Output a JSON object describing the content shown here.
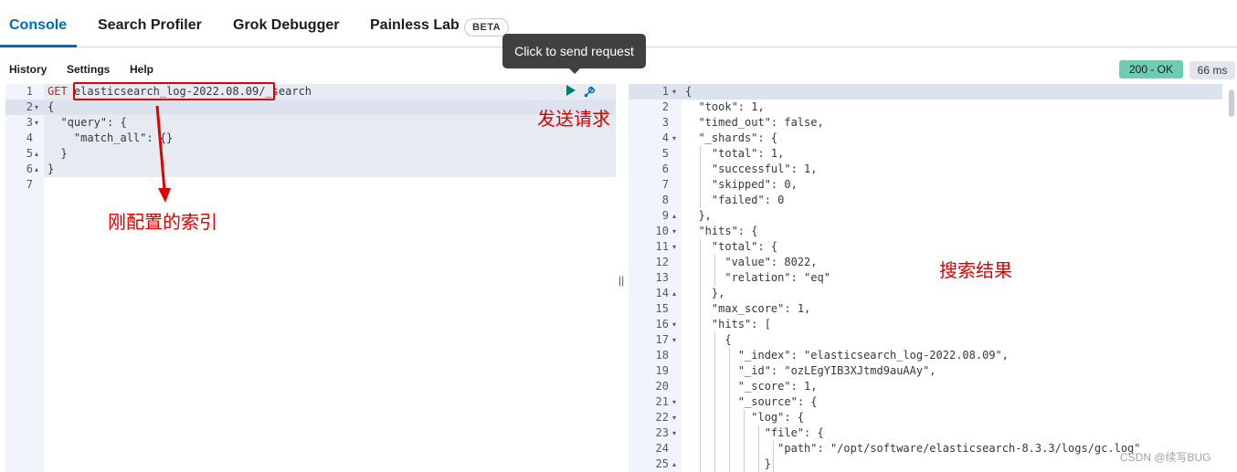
{
  "tabs": [
    {
      "label": "Console",
      "active": true
    },
    {
      "label": "Search Profiler",
      "active": false
    },
    {
      "label": "Grok Debugger",
      "active": false
    },
    {
      "label": "Painless Lab",
      "active": false
    }
  ],
  "beta_badge": "BETA",
  "menu": {
    "history": "History",
    "settings": "Settings",
    "help": "Help"
  },
  "tooltip": "Click to send request",
  "response": {
    "status": "200 - OK",
    "time": "66 ms"
  },
  "request": {
    "method": "GET",
    "index": "elasticsearch_log-2022.08.09",
    "path": "/_search",
    "lines": [
      {
        "n": "1",
        "fold": "",
        "text": ""
      },
      {
        "n": "2",
        "fold": "▾",
        "text": "{"
      },
      {
        "n": "3",
        "fold": "▾",
        "text": "  \"query\": {"
      },
      {
        "n": "4",
        "fold": "",
        "text": "    \"match_all\": {}"
      },
      {
        "n": "5",
        "fold": "▴",
        "text": "  }"
      },
      {
        "n": "6",
        "fold": "▴",
        "text": "}"
      },
      {
        "n": "7",
        "fold": "",
        "text": ""
      }
    ]
  },
  "response_lines": [
    {
      "n": "1",
      "fold": "▾",
      "text": "{"
    },
    {
      "n": "2",
      "fold": "",
      "text": "  \"took\": 1,"
    },
    {
      "n": "3",
      "fold": "",
      "text": "  \"timed_out\": false,"
    },
    {
      "n": "4",
      "fold": "▾",
      "text": "  \"_shards\": {"
    },
    {
      "n": "5",
      "fold": "",
      "text": "    \"total\": 1,"
    },
    {
      "n": "6",
      "fold": "",
      "text": "    \"successful\": 1,"
    },
    {
      "n": "7",
      "fold": "",
      "text": "    \"skipped\": 0,"
    },
    {
      "n": "8",
      "fold": "",
      "text": "    \"failed\": 0"
    },
    {
      "n": "9",
      "fold": "▴",
      "text": "  },"
    },
    {
      "n": "10",
      "fold": "▾",
      "text": "  \"hits\": {"
    },
    {
      "n": "11",
      "fold": "▾",
      "text": "    \"total\": {"
    },
    {
      "n": "12",
      "fold": "",
      "text": "      \"value\": 8022,"
    },
    {
      "n": "13",
      "fold": "",
      "text": "      \"relation\": \"eq\""
    },
    {
      "n": "14",
      "fold": "▴",
      "text": "    },"
    },
    {
      "n": "15",
      "fold": "",
      "text": "    \"max_score\": 1,"
    },
    {
      "n": "16",
      "fold": "▾",
      "text": "    \"hits\": ["
    },
    {
      "n": "17",
      "fold": "▾",
      "text": "      {"
    },
    {
      "n": "18",
      "fold": "",
      "text": "        \"_index\": \"elasticsearch_log-2022.08.09\","
    },
    {
      "n": "19",
      "fold": "",
      "text": "        \"_id\": \"ozLEgYIB3XJtmd9auAAy\","
    },
    {
      "n": "20",
      "fold": "",
      "text": "        \"_score\": 1,"
    },
    {
      "n": "21",
      "fold": "▾",
      "text": "        \"_source\": {"
    },
    {
      "n": "22",
      "fold": "▾",
      "text": "          \"log\": {"
    },
    {
      "n": "23",
      "fold": "▾",
      "text": "            \"file\": {"
    },
    {
      "n": "24",
      "fold": "",
      "text": "              \"path\": \"/opt/software/elasticsearch-8.3.3/logs/gc.log\""
    },
    {
      "n": "25",
      "fold": "▴",
      "text": "            }"
    }
  ],
  "annotations": {
    "index_note": "刚配置的索引",
    "send_note": "发送请求",
    "result_note": "搜索结果"
  },
  "watermark": "CSDN @续写BUG",
  "colors": {
    "accent": "#006bb8",
    "status_ok": "#6dccb1",
    "annotation": "#e00000"
  }
}
